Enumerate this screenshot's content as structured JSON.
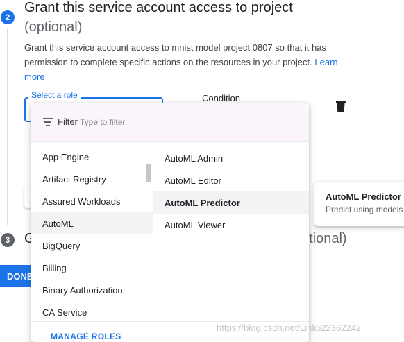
{
  "step2": {
    "number": "2",
    "title": "Grant this service account access to project",
    "optional": "(optional)",
    "description": "Grant this service account access to mnist model project 0807 so that it has permission to complete specific actions on the resources in your project.",
    "learn_more": "Learn more"
  },
  "role_field": {
    "label": "Select a role"
  },
  "condition_label": "Condition",
  "dropdown": {
    "filter_label": "Filter",
    "filter_placeholder": "Type to filter",
    "services": [
      "App Engine",
      "Artifact Registry",
      "Assured Workloads",
      "AutoML",
      "BigQuery",
      "Billing",
      "Binary Authorization",
      "CA Service"
    ],
    "selected_service": "AutoML",
    "roles": [
      "AutoML Admin",
      "AutoML Editor",
      "AutoML Predictor",
      "AutoML Viewer"
    ],
    "selected_role": "AutoML Predictor",
    "manage_roles": "MANAGE ROLES"
  },
  "role_tooltip": {
    "title": "AutoML Predictor",
    "description": "Predict using models"
  },
  "step3": {
    "number": "3",
    "title_start": "G",
    "title_end": "ptional)"
  },
  "done_button": "DONE",
  "watermark": "https://blog.csdn.net/Linli522362242",
  "colors": {
    "accent": "#1a73e8",
    "filter_bg": "#fcf6fc",
    "selected_bg": "#f1f3f4"
  }
}
